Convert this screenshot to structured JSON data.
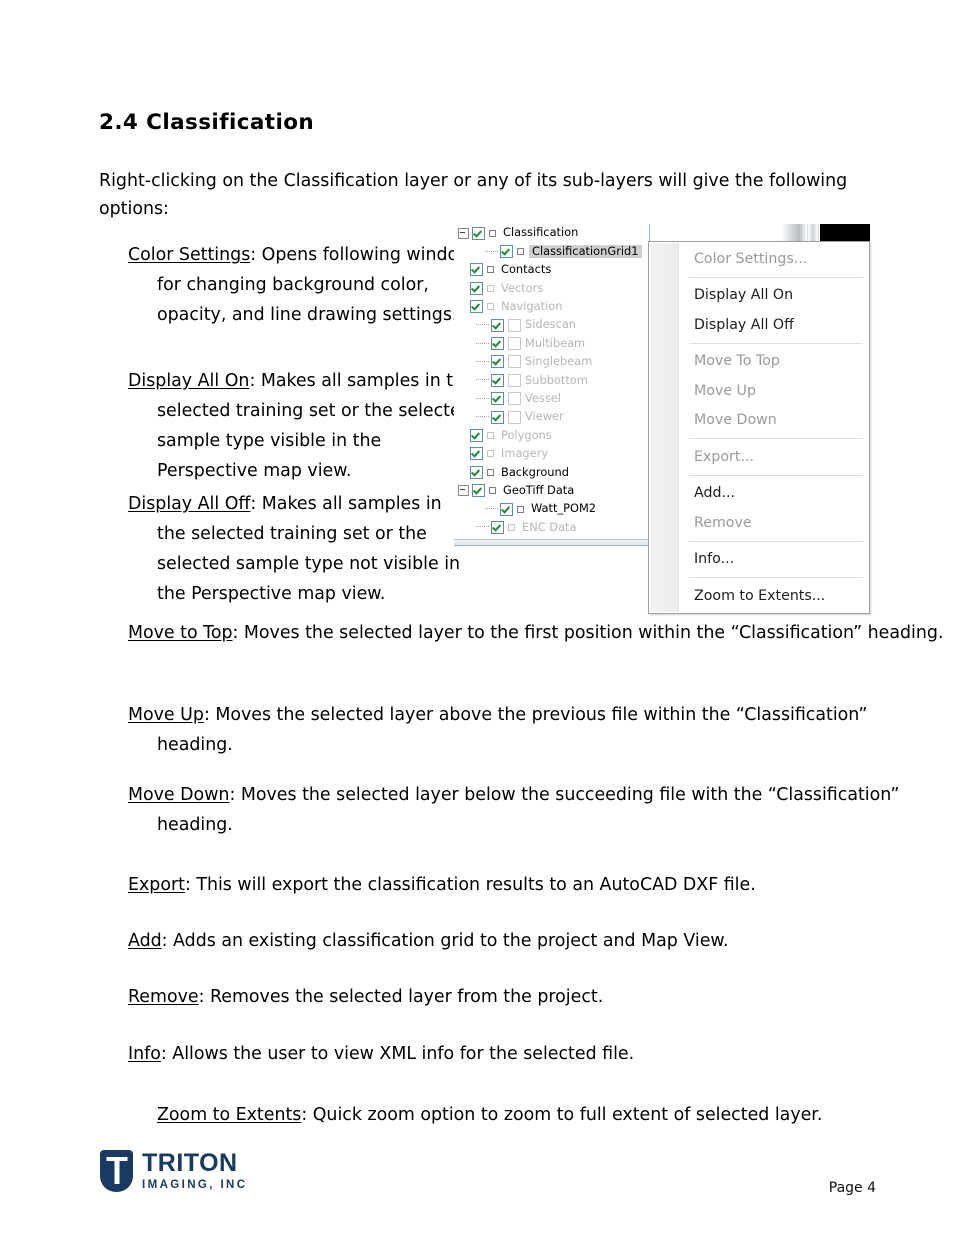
{
  "document": {
    "section_heading": "2.4 Classification",
    "intro": "Right-clicking on the Classification layer or any of its sub-layers will give the following options:",
    "page_label": "Page 4"
  },
  "definitions": [
    {
      "term": "Color Settings",
      "text": ":  Opens following window for changing background color, opacity, and line drawing settings."
    },
    {
      "term": "Display All On",
      "text": ":  Makes all samples in the selected training set or the selected sample type visible in the Perspective map view."
    },
    {
      "term": "Display All Off",
      "text": ":  Makes all samples in the selected training set or the selected sample type not visible in the Perspective map view."
    },
    {
      "term": "Move to Top",
      "text": ":  Moves the selected layer to the first position within the “Classification” heading."
    },
    {
      "term": "Move Up",
      "text": ":  Moves the selected layer above the previous file within the “Classification” heading."
    },
    {
      "term": "Move Down",
      "text": ":  Moves the selected layer below the succeeding file with the “Classification” heading."
    },
    {
      "term": "Export",
      "text": ":  This will export the classification results to an AutoCAD DXF file."
    },
    {
      "term": "Add",
      "text": ":  Adds an existing classification grid to the project and Map View."
    },
    {
      "term": "Remove",
      "text": ":  Removes the selected layer from the project."
    },
    {
      "term": "Info",
      "text": ":  Allows the user to view XML info for the selected file."
    },
    {
      "term": "Zoom to Extents",
      "text": ":  Quick zoom option to zoom to full extent of selected layer."
    }
  ],
  "screenshot": {
    "layer_tree": [
      {
        "label": "Classification",
        "level": 0,
        "checked": true,
        "enabled": true,
        "expander": "minus",
        "selected": false,
        "second_box": false
      },
      {
        "label": "ClassificationGrid1",
        "level": 2,
        "checked": true,
        "enabled": true,
        "expander": "none",
        "selected": true,
        "second_box": false
      },
      {
        "label": "Contacts",
        "level": 0,
        "checked": true,
        "enabled": true,
        "expander": "none",
        "selected": false,
        "second_box": false
      },
      {
        "label": "Vectors",
        "level": 0,
        "checked": true,
        "enabled": false,
        "expander": "none",
        "selected": false,
        "second_box": false
      },
      {
        "label": "Navigation",
        "level": 0,
        "checked": true,
        "enabled": false,
        "expander": "none",
        "selected": false,
        "second_box": false
      },
      {
        "label": "Sidescan",
        "level": 1,
        "checked": true,
        "enabled": false,
        "expander": "none",
        "selected": false,
        "second_box": true
      },
      {
        "label": "Multibeam",
        "level": 1,
        "checked": true,
        "enabled": false,
        "expander": "none",
        "selected": false,
        "second_box": true
      },
      {
        "label": "Singlebeam",
        "level": 1,
        "checked": true,
        "enabled": false,
        "expander": "none",
        "selected": false,
        "second_box": true
      },
      {
        "label": "Subbottom",
        "level": 1,
        "checked": true,
        "enabled": false,
        "expander": "none",
        "selected": false,
        "second_box": true
      },
      {
        "label": "Vessel",
        "level": 1,
        "checked": true,
        "enabled": false,
        "expander": "none",
        "selected": false,
        "second_box": true
      },
      {
        "label": "Viewer",
        "level": 1,
        "checked": true,
        "enabled": false,
        "expander": "none",
        "selected": false,
        "second_box": true
      },
      {
        "label": "Polygons",
        "level": 0,
        "checked": true,
        "enabled": false,
        "expander": "none",
        "selected": false,
        "second_box": false
      },
      {
        "label": "Imagery",
        "level": 0,
        "checked": true,
        "enabled": false,
        "expander": "none",
        "selected": false,
        "second_box": false
      },
      {
        "label": "Background",
        "level": 0,
        "checked": true,
        "enabled": true,
        "expander": "none",
        "selected": false,
        "second_box": false
      },
      {
        "label": "GeoTiff Data",
        "level": 0,
        "checked": true,
        "enabled": true,
        "expander": "minus",
        "selected": false,
        "second_box": false
      },
      {
        "label": "Watt_POM2",
        "level": 2,
        "checked": true,
        "enabled": true,
        "expander": "none",
        "selected": false,
        "second_box": false
      },
      {
        "label": "ENC Data",
        "level": 1,
        "checked": true,
        "enabled": false,
        "expander": "none",
        "selected": false,
        "second_box": false
      }
    ],
    "context_menu": [
      {
        "label": "Color Settings...",
        "enabled": false,
        "separator_after": true
      },
      {
        "label": "Display All On",
        "enabled": true,
        "separator_after": false
      },
      {
        "label": "Display All Off",
        "enabled": true,
        "separator_after": true
      },
      {
        "label": "Move To Top",
        "enabled": false,
        "separator_after": false
      },
      {
        "label": "Move Up",
        "enabled": false,
        "separator_after": false
      },
      {
        "label": "Move Down",
        "enabled": false,
        "separator_after": true
      },
      {
        "label": "Export...",
        "enabled": false,
        "separator_after": true
      },
      {
        "label": "Add...",
        "enabled": true,
        "separator_after": false
      },
      {
        "label": "Remove",
        "enabled": false,
        "separator_after": true
      },
      {
        "label": "Info...",
        "enabled": true,
        "separator_after": true
      },
      {
        "label": "Zoom to Extents...",
        "enabled": true,
        "separator_after": false
      }
    ]
  },
  "footer": {
    "logo_name": "TRITON",
    "logo_tagline": "IMAGING, INC",
    "brand_color": "#183a63"
  }
}
